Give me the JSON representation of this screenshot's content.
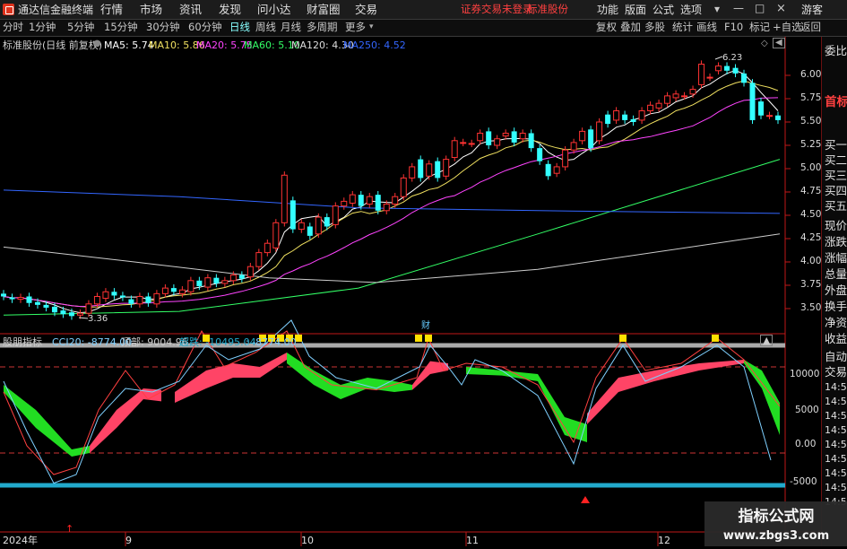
{
  "app": {
    "title": "通达信金融终端"
  },
  "menu": {
    "items": [
      "行情",
      "市场",
      "资讯",
      "发现",
      "问小达",
      "财富圈",
      "交易"
    ],
    "alert": "证券交易未登录",
    "standard": "标准股份",
    "right_items": [
      "功能",
      "版面",
      "公式",
      "选项"
    ],
    "guest": "游客"
  },
  "toolbar": {
    "periods": [
      "分时",
      "1分钟",
      "5分钟",
      "15分钟",
      "30分钟",
      "60分钟",
      "日线",
      "周线",
      "月线",
      "多周期",
      "更多"
    ],
    "active_period": "日线",
    "tools": [
      "复权",
      "叠加",
      "多股",
      "统计",
      "画线",
      "F10",
      "标记",
      "+自选",
      "返回"
    ]
  },
  "chart": {
    "stock_label": "标准股份(日线 前复权)",
    "ma_legend": [
      {
        "label": "MA5: 5.74",
        "color": "#ffffff"
      },
      {
        "label": "MA10: 5.86",
        "color": "#f0e060"
      },
      {
        "label": "MA20: 5.75",
        "color": "#ff44ff"
      },
      {
        "label": "MA60: 5.10",
        "color": "#33ff66"
      },
      {
        "label": "MA120: 4.30",
        "color": "#dddddd"
      },
      {
        "label": "MA250: 4.52",
        "color": "#3366ff"
      }
    ],
    "high_label": "6.23",
    "low_label": "3.36",
    "finance_marker": "财",
    "price_axis": [
      "6.00",
      "5.75",
      "5.50",
      "5.25",
      "5.00",
      "4.75",
      "4.50",
      "4.25",
      "4.00",
      "3.75",
      "3.50"
    ],
    "indicator": {
      "name": "股朋指标",
      "legend": [
        {
          "label": "CCI20: -8774.00",
          "color": "#7fd0ff"
        },
        {
          "label": "顶部: 9004.96",
          "color": "#cccccc"
        },
        {
          "label": "超跌: -10495.04",
          "color": "#22aacc"
        },
        {
          "label": ": -8774.00",
          "color": "#7fd0ff"
        }
      ],
      "axis": [
        "10000",
        "5000",
        "0.00",
        "-5000"
      ]
    },
    "date_axis": [
      "2024年",
      "9",
      "10",
      "11",
      "12"
    ],
    "colors": {
      "up": "#ff3333",
      "down": "#33ffff",
      "mid": "#ff4466",
      "green": "#22dd22",
      "axis_red": "#c01818"
    }
  },
  "chart_data": {
    "type": "candlestick",
    "price_range": [
      3.36,
      6.23
    ],
    "candles": [
      [
        3.66,
        3.63
      ],
      [
        3.62,
        3.6
      ],
      [
        3.6,
        3.62
      ],
      [
        3.63,
        3.56
      ],
      [
        3.57,
        3.54
      ],
      [
        3.54,
        3.51
      ],
      [
        3.52,
        3.46
      ],
      [
        3.48,
        3.44
      ],
      [
        3.46,
        3.42
      ],
      [
        3.43,
        3.45
      ],
      [
        3.45,
        3.55
      ],
      [
        3.55,
        3.63
      ],
      [
        3.61,
        3.68
      ],
      [
        3.68,
        3.64
      ],
      [
        3.64,
        3.62
      ],
      [
        3.6,
        3.55
      ],
      [
        3.55,
        3.63
      ],
      [
        3.63,
        3.56
      ],
      [
        3.55,
        3.66
      ],
      [
        3.66,
        3.72
      ],
      [
        3.72,
        3.68
      ],
      [
        3.66,
        3.7
      ],
      [
        3.68,
        3.8
      ],
      [
        3.8,
        3.74
      ],
      [
        3.73,
        3.83
      ],
      [
        3.83,
        3.77
      ],
      [
        3.77,
        3.8
      ],
      [
        3.8,
        3.86
      ],
      [
        3.86,
        3.82
      ],
      [
        3.84,
        3.95
      ],
      [
        3.95,
        4.1
      ],
      [
        4.1,
        4.2
      ],
      [
        4.15,
        4.42
      ],
      [
        4.42,
        4.93
      ],
      [
        4.66,
        4.35
      ],
      [
        4.35,
        4.42
      ],
      [
        4.38,
        4.28
      ],
      [
        4.3,
        4.48
      ],
      [
        4.48,
        4.38
      ],
      [
        4.4,
        4.6
      ],
      [
        4.6,
        4.65
      ],
      [
        4.63,
        4.72
      ],
      [
        4.72,
        4.6
      ],
      [
        4.62,
        4.7
      ],
      [
        4.72,
        4.55
      ],
      [
        4.55,
        4.62
      ],
      [
        4.62,
        4.7
      ],
      [
        4.7,
        4.9
      ],
      [
        4.9,
        5.02
      ],
      [
        5.1,
        4.9
      ],
      [
        4.92,
        5.05
      ],
      [
        5.08,
        4.9
      ],
      [
        4.92,
        5.1
      ],
      [
        5.12,
        5.3
      ],
      [
        5.28,
        5.28
      ],
      [
        5.27,
        5.27
      ],
      [
        5.3,
        5.38
      ],
      [
        5.4,
        5.25
      ],
      [
        5.25,
        5.32
      ],
      [
        5.35,
        5.38
      ],
      [
        5.4,
        5.28
      ],
      [
        5.32,
        5.38
      ],
      [
        5.38,
        5.22
      ],
      [
        5.22,
        5.08
      ],
      [
        5.05,
        4.92
      ],
      [
        4.95,
        5.02
      ],
      [
        5.02,
        5.2
      ],
      [
        5.2,
        5.28
      ],
      [
        5.3,
        5.4
      ],
      [
        5.42,
        5.22
      ],
      [
        5.3,
        5.5
      ],
      [
        5.58,
        5.48
      ],
      [
        5.52,
        5.62
      ],
      [
        5.58,
        5.52
      ],
      [
        5.53,
        5.5
      ],
      [
        5.52,
        5.62
      ],
      [
        5.62,
        5.68
      ],
      [
        5.65,
        5.7
      ],
      [
        5.7,
        5.78
      ],
      [
        5.76,
        5.8
      ],
      [
        5.78,
        5.78
      ],
      [
        5.8,
        5.85
      ],
      [
        5.9,
        6.12
      ],
      [
        5.98,
        5.98
      ],
      [
        6.05,
        6.1
      ],
      [
        6.1,
        6.05
      ],
      [
        6.08,
        6.02
      ],
      [
        6.02,
        5.92
      ],
      [
        5.92,
        5.52
      ],
      [
        5.72,
        5.57
      ],
      [
        5.57,
        5.57
      ],
      [
        5.57,
        5.52
      ]
    ]
  }
}
